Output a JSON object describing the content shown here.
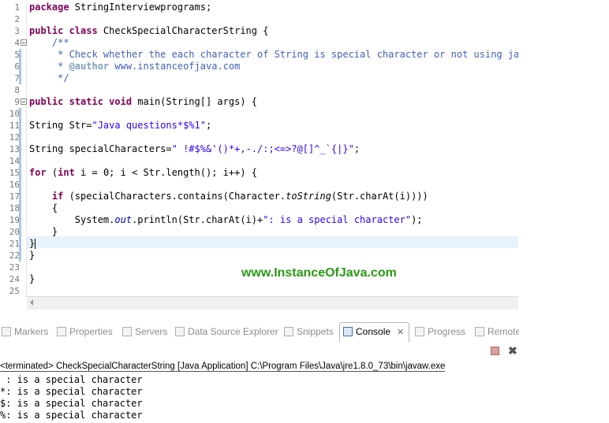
{
  "editor": {
    "lines": [
      {
        "n": "1",
        "html": "<span class=\"kw\">package</span> StringInterviewprograms;"
      },
      {
        "n": "2",
        "html": ""
      },
      {
        "n": "3",
        "html": "<span class=\"kw\">public class</span> CheckSpecialCharacterString {"
      },
      {
        "n": "4",
        "html": "    <span class=\"cm\">/**</span>"
      },
      {
        "n": "5",
        "html": "<span class=\"cm\">     * Check whether the each character of String is special character or not using java</span>"
      },
      {
        "n": "6",
        "html": "<span class=\"cm\">     * </span><span class=\"tag\">@author</span><span class=\"cm\"> www.instanceofjava.com</span>"
      },
      {
        "n": "7",
        "html": "<span class=\"cm\">     */</span>"
      },
      {
        "n": "8",
        "html": ""
      },
      {
        "n": "9",
        "html": "<span class=\"kw\">public static void</span> main(String[] args) {"
      },
      {
        "n": "10",
        "html": ""
      },
      {
        "n": "11",
        "html": "String Str=<span class=\"str\">\"Java questions*$%1\"</span>;"
      },
      {
        "n": "12",
        "html": ""
      },
      {
        "n": "13",
        "html": "String specialCharacters=<span class=\"str\">\" !#$%&amp;'()*+,-./:;&lt;=&gt;?@[]^_`{|}\"</span>;"
      },
      {
        "n": "14",
        "html": ""
      },
      {
        "n": "15",
        "html": "<span class=\"kw\">for</span> (<span class=\"kw\">int</span> i = 0; i &lt; Str.length(); i++) {"
      },
      {
        "n": "16",
        "html": ""
      },
      {
        "n": "17",
        "html": "    <span class=\"kw\">if</span> (specialCharacters.contains(Character.<span class=\"it\">toString</span>(Str.charAt(i))))"
      },
      {
        "n": "18",
        "html": "    {"
      },
      {
        "n": "19",
        "html": "        System.<span class=\"fld\">out</span>.println(Str.charAt(i)+<span class=\"str\">\": is a special character\"</span>);"
      },
      {
        "n": "20",
        "html": "    }"
      },
      {
        "n": "21",
        "html": "}<span class=\"caret\"></span>"
      },
      {
        "n": "22",
        "html": "}"
      },
      {
        "n": "23",
        "html": ""
      },
      {
        "n": "24",
        "html": "}"
      },
      {
        "n": "25",
        "html": ""
      }
    ],
    "watermark": "www.InstanceOfJava.com"
  },
  "panel": {
    "tabs": [
      {
        "label": "Markers",
        "icon": "markers-icon"
      },
      {
        "label": "Properties",
        "icon": "properties-icon"
      },
      {
        "label": "Servers",
        "icon": "servers-icon"
      },
      {
        "label": "Data Source Explorer",
        "icon": "data-source-icon"
      },
      {
        "label": "Snippets",
        "icon": "snippets-icon"
      },
      {
        "label": "Console",
        "icon": "console-icon",
        "active": true
      },
      {
        "label": "Progress",
        "icon": "progress-icon"
      },
      {
        "label": "Remote",
        "icon": "remote-icon"
      }
    ],
    "console_close": "✕"
  },
  "console": {
    "header_prefix": "<terminated> ",
    "header_class": "CheckSpecialCharacterString",
    "header_rest": " [Java Application] C:\\Program Files\\Java\\jre1.8.0_73\\bin\\javaw.exe",
    "output": [
      " : is a special character",
      "*: is a special character",
      "$: is a special character",
      "%: is a special character"
    ]
  },
  "colors": {
    "keyword": "#7f0055",
    "string": "#2a00ff",
    "comment": "#3f5fbf",
    "watermark": "#2a9a14",
    "current_line": "#e8f2fe"
  }
}
